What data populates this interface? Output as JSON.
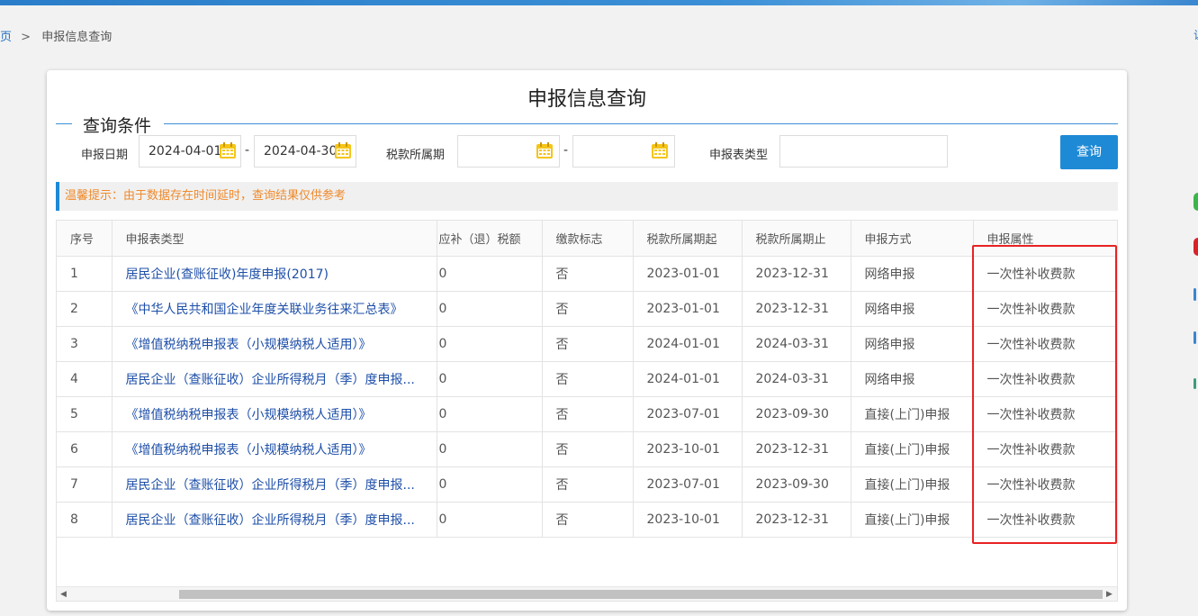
{
  "breadcrumb": {
    "home": "页",
    "separator": ">",
    "current": "申报信息查询"
  },
  "right_edge_text": "让",
  "page_title": "申报信息查询",
  "query_section": {
    "legend": "查询条件",
    "declare_date_label": "申报日期",
    "declare_date_start": "2024-04-01",
    "declare_date_end": "2024-04-30",
    "tax_period_label": "税款所属期",
    "tax_period_start": "",
    "tax_period_end": "",
    "form_type_label": "申报表类型",
    "form_type_value": "",
    "date_separator": "-",
    "query_button": "查询"
  },
  "tip": "温馨提示：由于数据存在时间延时，查询结果仅供参考",
  "table": {
    "columns": [
      "序号",
      "申报表类型",
      "应补（退）税额",
      "缴款标志",
      "税款所属期起",
      "税款所属期止",
      "申报方式",
      "申报属性"
    ],
    "rows": [
      [
        "1",
        "居民企业(查账征收)年度申报(2017)",
        "0",
        "否",
        "2023-01-01",
        "2023-12-31",
        "网络申报",
        "一次性补收费款"
      ],
      [
        "2",
        "《中华人民共和国企业年度关联业务往来汇总表》",
        "0",
        "否",
        "2023-01-01",
        "2023-12-31",
        "网络申报",
        "一次性补收费款"
      ],
      [
        "3",
        "《增值税纳税申报表（小规模纳税人适用）》",
        "0",
        "否",
        "2024-01-01",
        "2024-03-31",
        "网络申报",
        "一次性补收费款"
      ],
      [
        "4",
        "居民企业（查账征收）企业所得税月（季）度申报...",
        "0",
        "否",
        "2024-01-01",
        "2024-03-31",
        "网络申报",
        "一次性补收费款"
      ],
      [
        "5",
        "《增值税纳税申报表（小规模纳税人适用）》",
        "0",
        "否",
        "2023-07-01",
        "2023-09-30",
        "直接(上门)申报",
        "一次性补收费款"
      ],
      [
        "6",
        "《增值税纳税申报表（小规模纳税人适用）》",
        "0",
        "否",
        "2023-10-01",
        "2023-12-31",
        "直接(上门)申报",
        "一次性补收费款"
      ],
      [
        "7",
        "居民企业（查账征收）企业所得税月（季）度申报...",
        "0",
        "否",
        "2023-07-01",
        "2023-09-30",
        "直接(上门)申报",
        "一次性补收费款"
      ],
      [
        "8",
        "居民企业（查账征收）企业所得税月（季）度申报...",
        "0",
        "否",
        "2023-10-01",
        "2023-12-31",
        "直接(上门)申报",
        "一次性补收费款"
      ]
    ]
  },
  "colors": {
    "accent": "#1e8ad6",
    "link": "#1e4fa8",
    "tip": "#f08a2b",
    "highlight_box": "#e82222",
    "calendar_icon": "#f5c518"
  }
}
